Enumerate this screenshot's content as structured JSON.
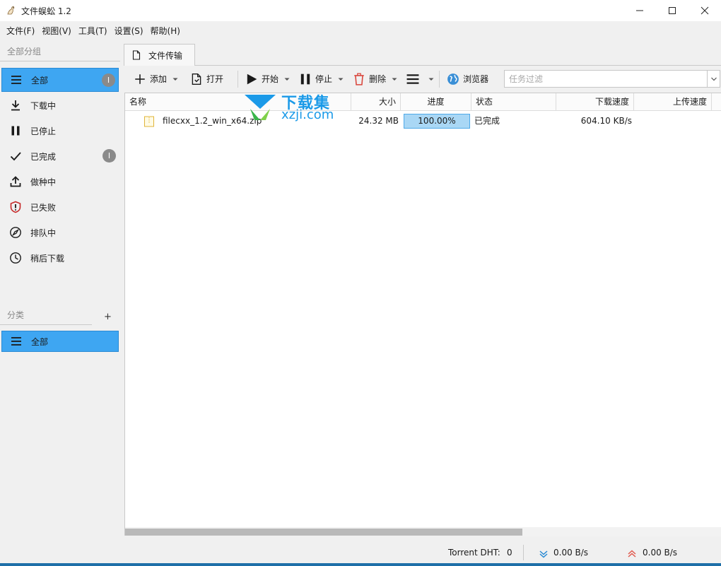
{
  "window": {
    "title": "文件蜈蚣 1.2"
  },
  "menu": [
    "文件(F)",
    "视图(V)",
    "工具(T)",
    "设置(S)",
    "帮助(H)"
  ],
  "sidebar": {
    "group_header": "全部分组",
    "items": [
      {
        "label": "全部",
        "icon": "list-icon",
        "badge": "I",
        "active": true
      },
      {
        "label": "下载中",
        "icon": "download-icon"
      },
      {
        "label": "已停止",
        "icon": "pause-icon"
      },
      {
        "label": "已完成",
        "icon": "check-icon",
        "badge": "I"
      },
      {
        "label": "做种中",
        "icon": "upload-icon"
      },
      {
        "label": "已失败",
        "icon": "shield-alert-icon"
      },
      {
        "label": "排队中",
        "icon": "compass-icon"
      },
      {
        "label": "稍后下载",
        "icon": "clock-icon"
      }
    ],
    "category_header": "分类",
    "add_category": "+",
    "categories": [
      {
        "label": "全部",
        "icon": "list-icon",
        "active": true
      }
    ]
  },
  "tab": {
    "label": "文件传输"
  },
  "toolbar": {
    "add": "添加",
    "open": "打开",
    "start": "开始",
    "stop": "停止",
    "delete": "删除",
    "browser": "浏览器",
    "filter_placeholder": "任务过滤"
  },
  "table": {
    "columns": [
      "名称",
      "大小",
      "进度",
      "状态",
      "下载速度",
      "上传速度"
    ],
    "rows": [
      {
        "name": "filecxx_1.2_win_x64.zip",
        "size": "24.32 MB",
        "progress_text": "100.00%",
        "progress": 1.0,
        "status": "已完成",
        "download_speed": "604.10 KB/s",
        "upload_speed": ""
      }
    ]
  },
  "watermark": {
    "title": "下载集",
    "url": "xzji.com"
  },
  "statusbar": {
    "dht_label": "Torrent DHT:",
    "dht_value": "0",
    "download_rate": "0.00 B/s",
    "upload_rate": "0.00 B/s"
  },
  "colors": {
    "accent": "#3ea6f2",
    "progress_fill": "#a9d7f5",
    "download_arrow": "#2a8ad4",
    "upload_arrow": "#e05a4e"
  }
}
